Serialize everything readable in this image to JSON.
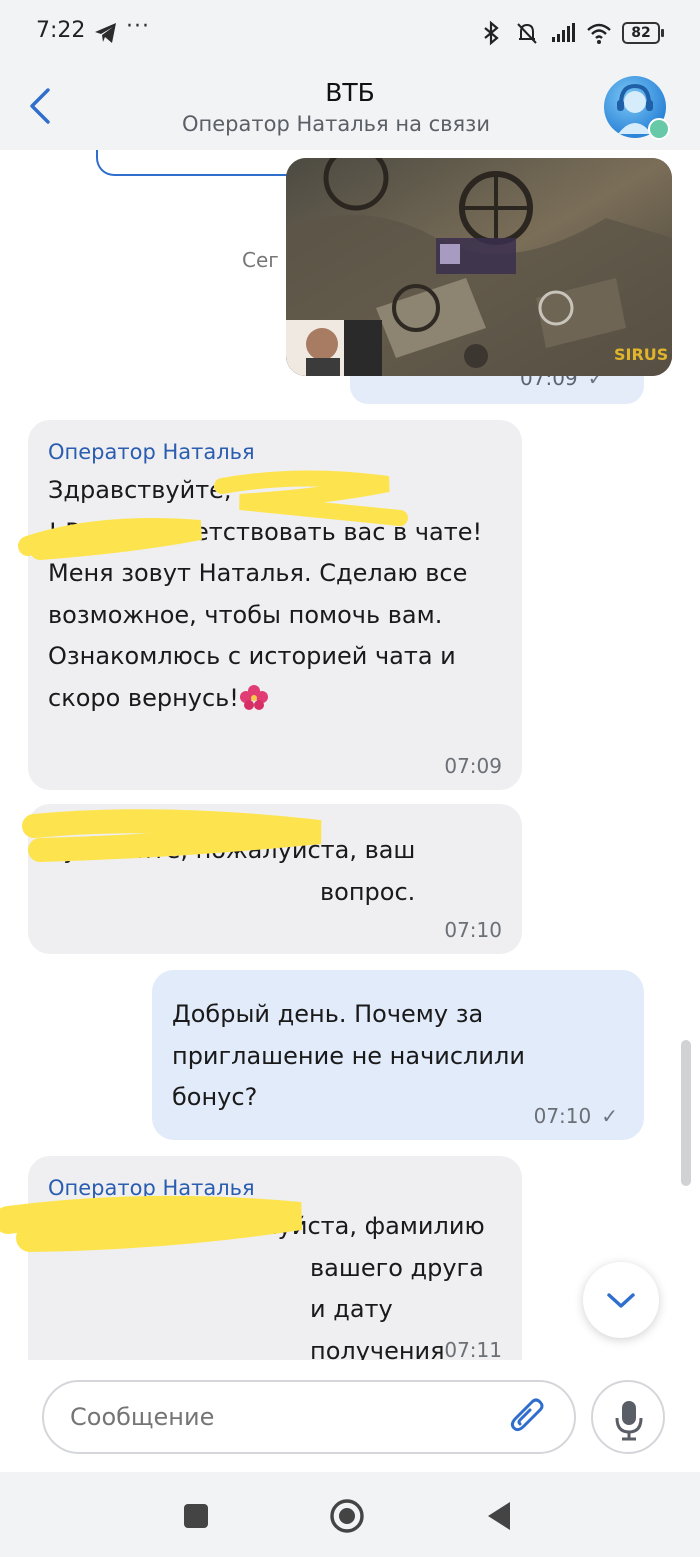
{
  "status_bar": {
    "time": "7:22",
    "more": "···",
    "battery": "82"
  },
  "header": {
    "title": "ВТБ",
    "subtitle": "Оператор Наталья на связи"
  },
  "chat": {
    "date_separator_partial": "Сег",
    "earlier_outgoing_time": "07:09",
    "messages": [
      {
        "direction": "incoming",
        "sender": "Оператор Наталья",
        "text": "Здравствуйте,\n! Рада приветствовать вас в чате! Меня зовут Наталья. Сделаю все возможное, чтобы помочь вам. Ознакомлюсь с историей чата и скоро вернусь!",
        "time": "07:09"
      },
      {
        "direction": "incoming",
        "text": ", уточните, пожалуйста, ваш вопрос.",
        "time": "07:10"
      },
      {
        "direction": "outgoing",
        "text": "Добрый день. Почему за приглашение не начислили бонус?",
        "time": "07:10",
        "status": "✓"
      },
      {
        "direction": "incoming",
        "sender": "Оператор Наталья",
        "text": ", уточните, пожалуйста, фамилию вашего друга и дату получения карты.",
        "time": "07:11"
      }
    ]
  },
  "image_message": {
    "watermark": "SIRUS"
  },
  "composer": {
    "placeholder": "Сообщение"
  },
  "icons": {
    "back": "chevron-left-icon",
    "attach": "paperclip-icon",
    "mic": "microphone-icon",
    "scroll_down": "chevron-down-icon"
  },
  "colors": {
    "accent": "#2f6ecc",
    "incoming_bubble": "#efeff1",
    "outgoing_bubble": "#e2ebfa",
    "sender_name": "#2a5db0",
    "redaction": "#fde44f"
  }
}
